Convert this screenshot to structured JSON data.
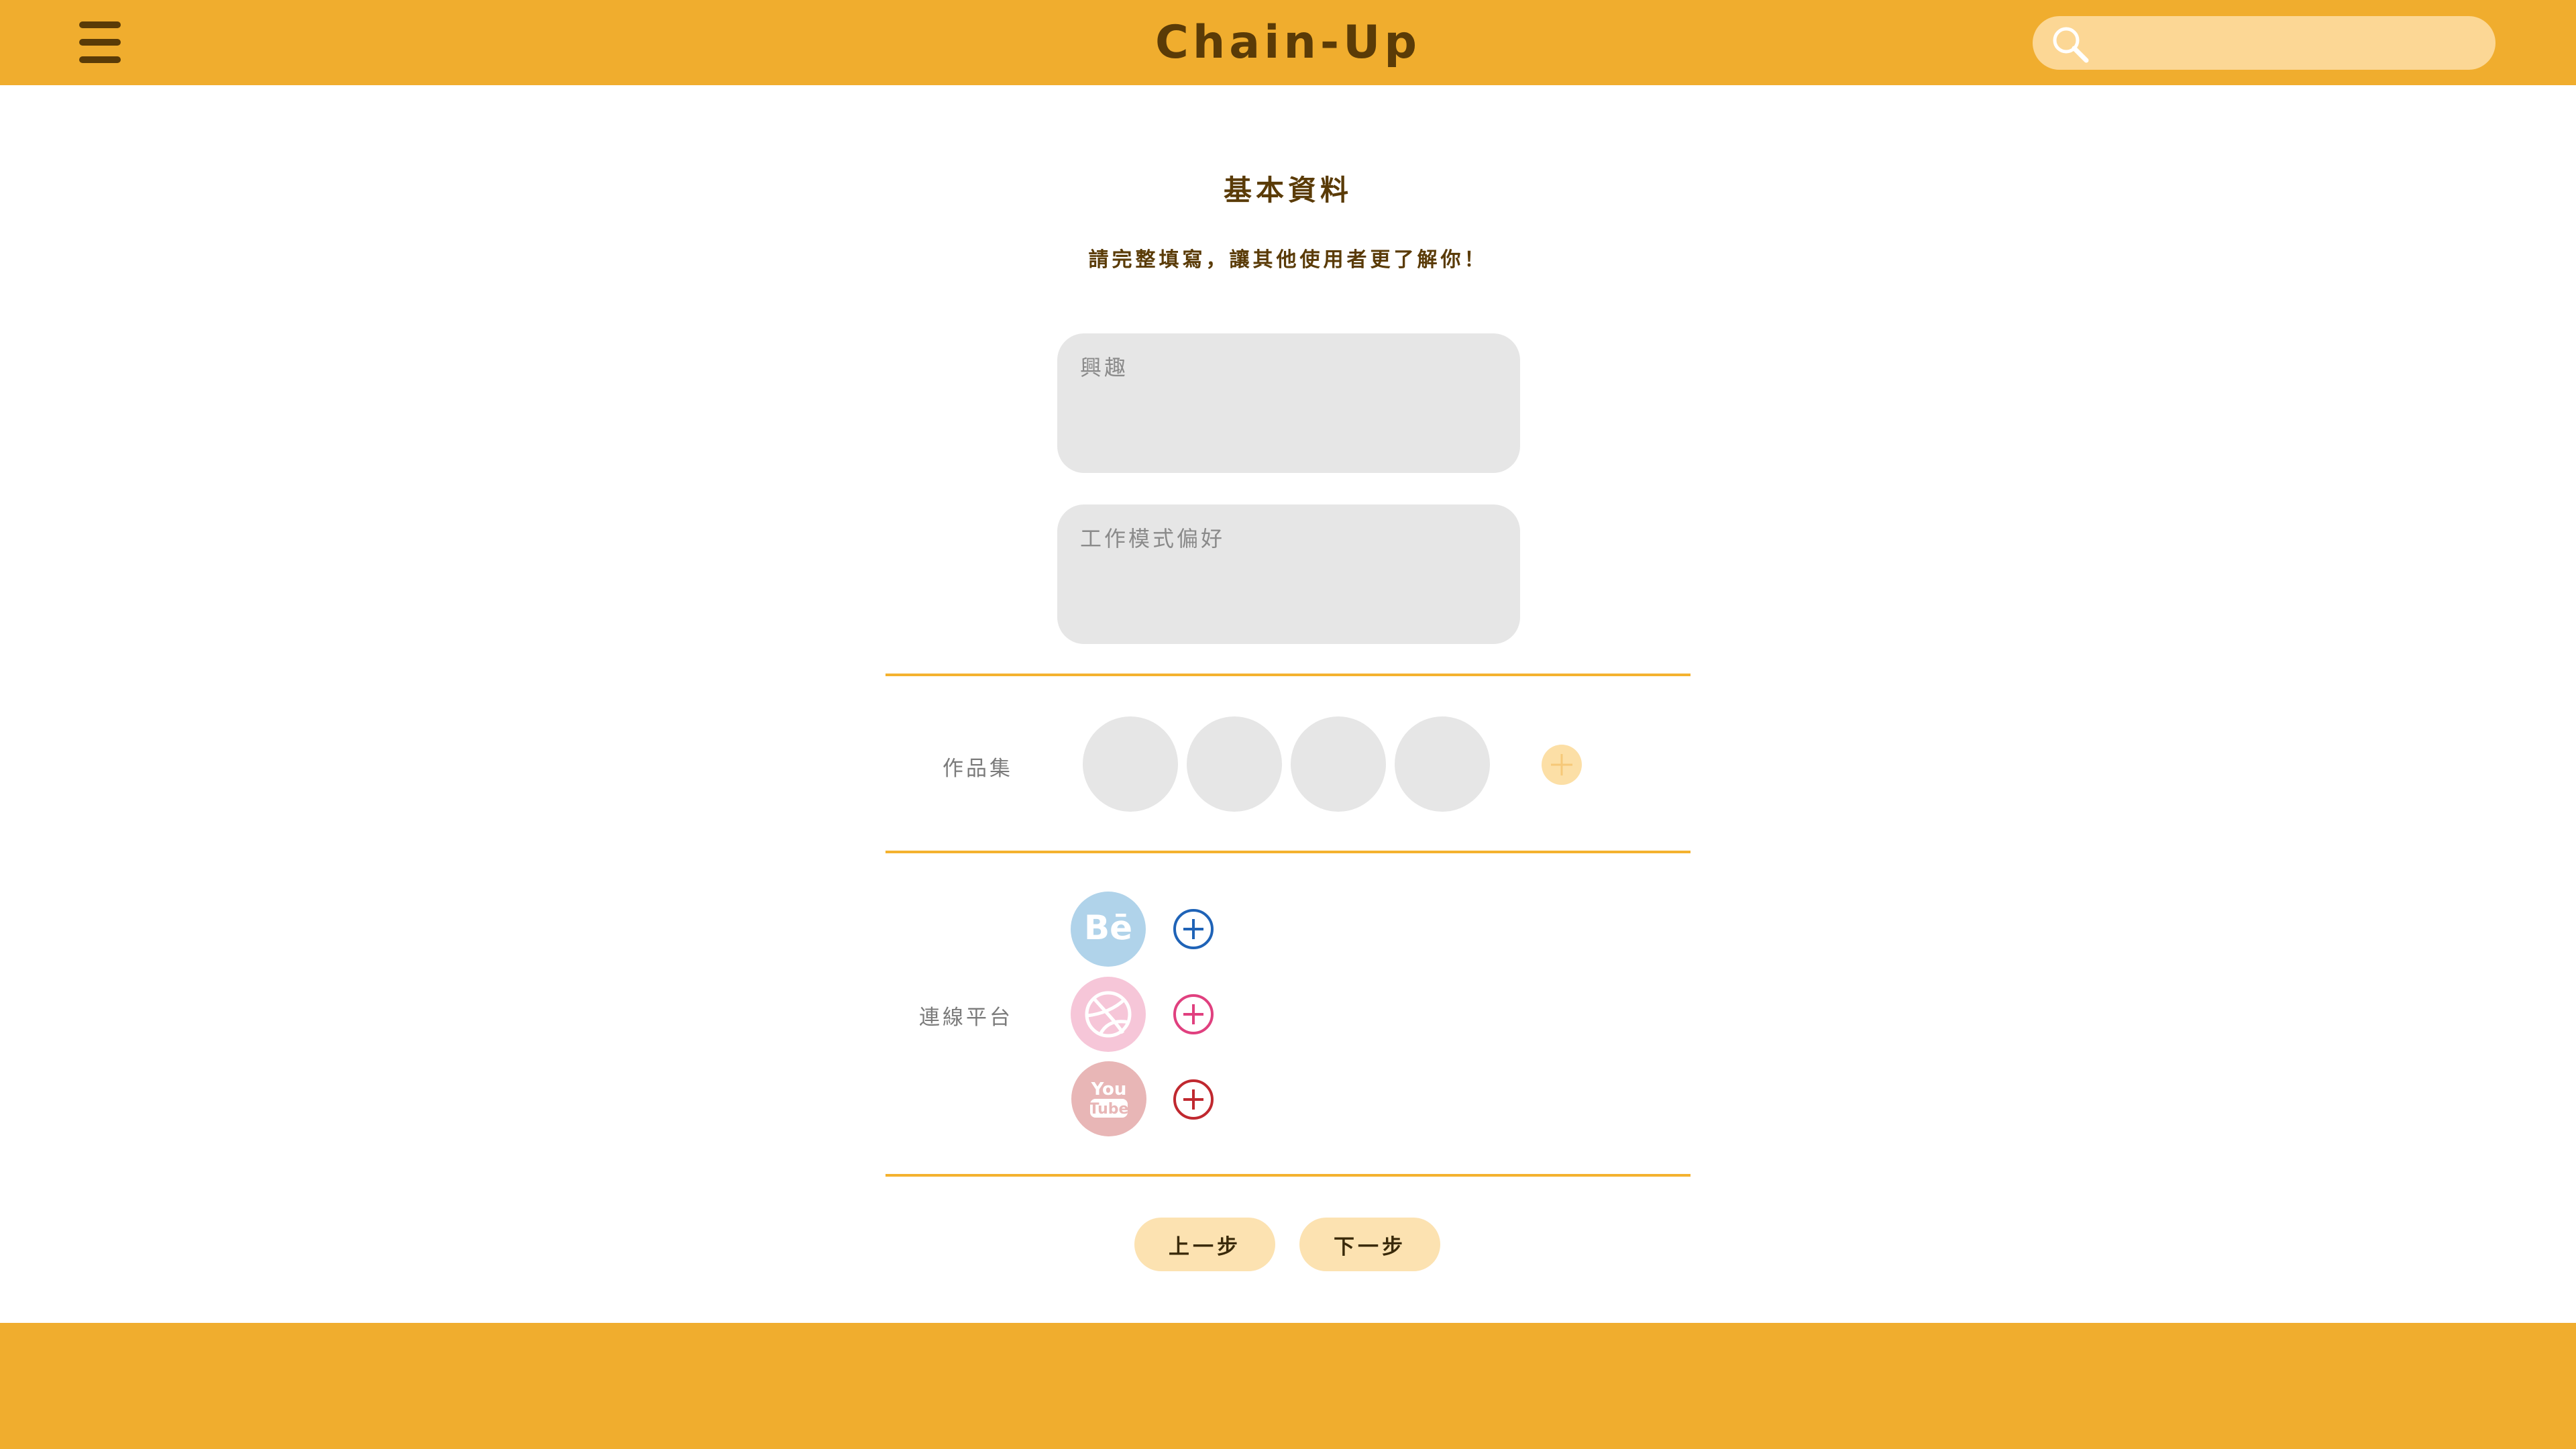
{
  "header": {
    "brand": "Chain-Up",
    "menu_icon": "hamburger-menu-icon",
    "search_icon": "search-icon",
    "search_placeholder": "",
    "background_color": "#f0ad2e",
    "text_color": "#5a3b07"
  },
  "form": {
    "title": "基本資料",
    "subtitle": "請完整填寫，讓其他使用者更了解你！",
    "interest_placeholder": "興趣",
    "work_preference_placeholder": "工作模式偏好"
  },
  "portfolio": {
    "label": "作品集",
    "slots": 4,
    "add_icon": "plus-icon"
  },
  "platforms": {
    "label": "連線平台",
    "items": [
      {
        "name": "Behance",
        "icon": "behance-icon",
        "add_color": "#1f63b7"
      },
      {
        "name": "Dribbble",
        "icon": "dribbble-icon",
        "add_color": "#e0407f"
      },
      {
        "name": "YouTube",
        "icon": "youtube-icon",
        "add_color": "#c0282f"
      }
    ]
  },
  "navigation": {
    "prev_label": "上一步",
    "next_label": "下一步"
  },
  "colors": {
    "accent": "#f0ad2e",
    "divider": "#f4b22f",
    "field_background": "#e6e6e6",
    "button_background": "#fce2b1"
  }
}
